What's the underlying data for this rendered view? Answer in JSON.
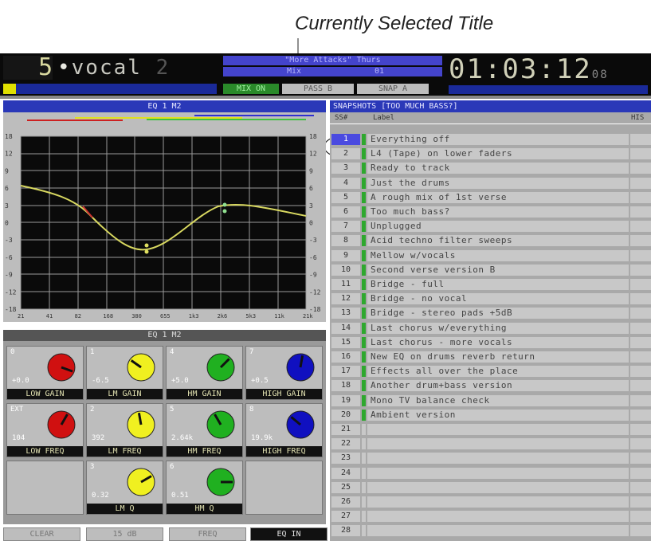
{
  "callout": {
    "title": "Currently Selected Title"
  },
  "topbar": {
    "channel_number": "5",
    "channel_name": "vocal",
    "channel_suffix": "2",
    "title_line": "\"More Attacks\" Thurs",
    "mix_label": "Mix",
    "mix_value": "01",
    "time": "01:03:12",
    "time_suffix": "08",
    "buttons": [
      "MIX ON",
      "PASS B",
      "SNAP A"
    ]
  },
  "eq": {
    "header": "EQ 1  M2",
    "header2": "EQ 1  M2",
    "y_ticks": [
      "18",
      "12",
      "9",
      "6",
      "3",
      "0",
      "-3",
      "-6",
      "-9",
      "-12",
      "-18"
    ],
    "x_ticks": [
      "21",
      "41",
      "82",
      "168",
      "380",
      "655",
      "1k3",
      "2k6",
      "5k3",
      "11k",
      "21k"
    ],
    "knobs": [
      {
        "num": "0",
        "value": "+0.0",
        "label": "LOW GAIN",
        "color": "#d01010"
      },
      {
        "num": "1",
        "value": "-6.5",
        "label": "LM GAIN",
        "color": "#f0f020"
      },
      {
        "num": "4",
        "value": "+5.0",
        "label": "HM GAIN",
        "color": "#20b020"
      },
      {
        "num": "7",
        "value": "+0.5",
        "label": "HIGH GAIN",
        "color": "#1010c0"
      },
      {
        "num": "EXT",
        "value": "104",
        "label": "LOW FREQ",
        "color": "#d01010"
      },
      {
        "num": "2",
        "value": "392",
        "label": "LM FREQ",
        "color": "#f0f020"
      },
      {
        "num": "5",
        "value": "2.64k",
        "label": "HM FREQ",
        "color": "#20b020"
      },
      {
        "num": "8",
        "value": "19.9k",
        "label": "HIGH FREQ",
        "color": "#1010c0"
      },
      {
        "num": "3",
        "value": "0.32",
        "label": "LM Q",
        "color": "#f0f020"
      },
      {
        "num": "6",
        "value": "0.51",
        "label": "HM Q",
        "color": "#20b020"
      }
    ],
    "bottom_buttons": [
      "CLEAR",
      "15 dB",
      "FREQ",
      "EQ IN"
    ]
  },
  "snapshots": {
    "header": "SNAPSHOTS [TOO MUCH BASS?]",
    "col_num": "SS#",
    "col_label": "Label",
    "col_extra": "HIS",
    "rows": [
      {
        "n": "1",
        "label": "Everything off"
      },
      {
        "n": "2",
        "label": "L4 (Tape) on lower faders"
      },
      {
        "n": "3",
        "label": "Ready to track"
      },
      {
        "n": "4",
        "label": "Just the drums"
      },
      {
        "n": "5",
        "label": "A rough mix of 1st verse"
      },
      {
        "n": "6",
        "label": "Too much bass?"
      },
      {
        "n": "7",
        "label": "Unplugged"
      },
      {
        "n": "8",
        "label": "Acid techno filter sweeps"
      },
      {
        "n": "9",
        "label": "Mellow w/vocals"
      },
      {
        "n": "10",
        "label": "Second verse version B"
      },
      {
        "n": "11",
        "label": "Bridge - full"
      },
      {
        "n": "12",
        "label": "Bridge - no vocal"
      },
      {
        "n": "13",
        "label": "Bridge - stereo pads +5dB"
      },
      {
        "n": "14",
        "label": "Last chorus w/everything"
      },
      {
        "n": "15",
        "label": "Last chorus - more vocals"
      },
      {
        "n": "16",
        "label": "New EQ on drums reverb return"
      },
      {
        "n": "17",
        "label": "Effects all over the place"
      },
      {
        "n": "18",
        "label": "Another drum+bass version"
      },
      {
        "n": "19",
        "label": "Mono TV balance check"
      },
      {
        "n": "20",
        "label": "Ambient version"
      },
      {
        "n": "21",
        "label": ""
      },
      {
        "n": "22",
        "label": ""
      },
      {
        "n": "23",
        "label": ""
      },
      {
        "n": "24",
        "label": ""
      },
      {
        "n": "25",
        "label": ""
      },
      {
        "n": "26",
        "label": ""
      },
      {
        "n": "27",
        "label": ""
      },
      {
        "n": "28",
        "label": ""
      }
    ]
  }
}
